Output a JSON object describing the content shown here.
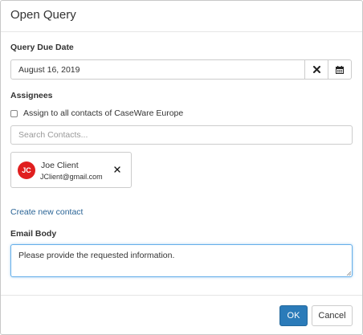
{
  "dialog": {
    "title": "Open Query"
  },
  "due_date": {
    "label": "Query Due Date",
    "value": "August 16, 2019",
    "clear_icon": "close-icon",
    "calendar_icon": "calendar-icon"
  },
  "assignees": {
    "label": "Assignees",
    "assign_all_label": "Assign to all contacts of CaseWare Europe",
    "assign_all_checked": false,
    "search_placeholder": "Search Contacts...",
    "contacts": [
      {
        "initials": "JC",
        "name": "Joe Client",
        "email": "JClient@gmail.com",
        "avatar_color": "#e01f1f"
      }
    ],
    "create_link": "Create new contact"
  },
  "email": {
    "label": "Email Body",
    "value": "Please provide the requested information."
  },
  "footer": {
    "ok_label": "OK",
    "cancel_label": "Cancel"
  },
  "colors": {
    "primary": "#2b7bb9",
    "link": "#2a6496",
    "focus_border": "#66afe9"
  }
}
